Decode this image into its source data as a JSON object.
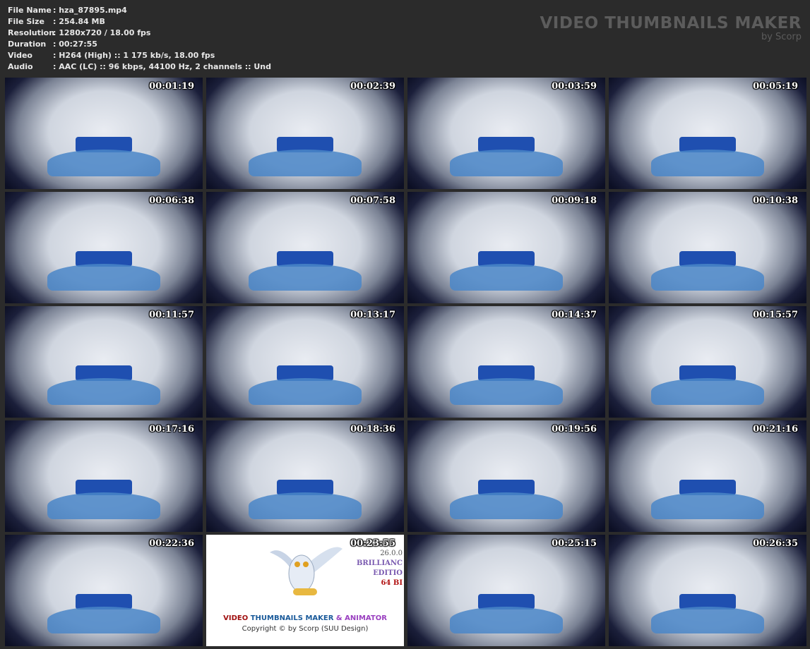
{
  "info": [
    {
      "key": "File Name",
      "value": ": hza_87895.mp4"
    },
    {
      "key": "File Size",
      "value": ": 254.84 MB"
    },
    {
      "key": "Resolution",
      "value": ": 1280x720 / 18.00 fps"
    },
    {
      "key": "Duration",
      "value": ": 00:27:55"
    },
    {
      "key": "Video",
      "value": ": H264 (High) :: 1 175 kb/s, 18.00 fps"
    },
    {
      "key": "Audio",
      "value": ": AAC (LC) :: 96 kbps, 44100 Hz, 2 channels :: Und"
    }
  ],
  "brand": {
    "title": "VIDEO THUMBNAILS MAKER",
    "sub": "by Scorp"
  },
  "timestamps": [
    "00:01:19",
    "00:02:39",
    "00:03:59",
    "00:05:19",
    "00:06:38",
    "00:07:58",
    "00:09:18",
    "00:10:38",
    "00:11:57",
    "00:13:17",
    "00:14:37",
    "00:15:57",
    "00:17:16",
    "00:18:36",
    "00:19:56",
    "00:21:16",
    "00:22:36",
    "00:23:55",
    "00:25:15",
    "00:26:35"
  ],
  "logo": {
    "video": "VIDEO",
    "thumbs": "THUMBNAILS MAKER",
    "amp": "& ANIMATOR",
    "copyright": "Copyright © by Scorp (SUU Design)",
    "version": "26.0.0",
    "brilliant": "BRILLIANC",
    "edition": "EDITIO",
    "bits": "64 BI"
  },
  "colors": {
    "red": "#a01010",
    "blue": "#1a5a9a",
    "purple": "#9a40c0"
  }
}
